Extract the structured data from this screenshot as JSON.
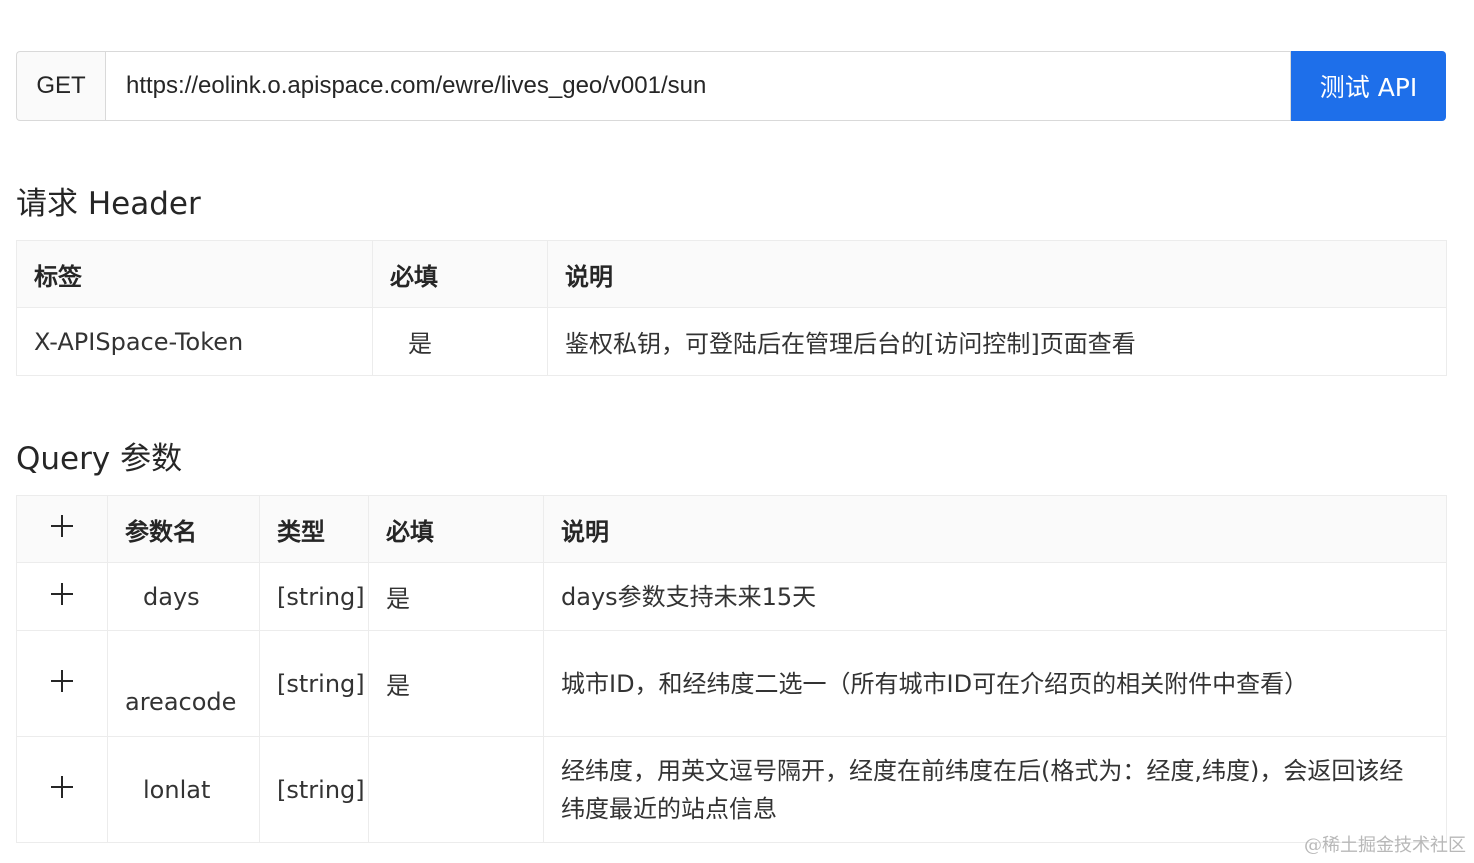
{
  "request": {
    "method": "GET",
    "url": "https://eolink.o.apispace.com/ewre/lives_geo/v001/sun",
    "test_button": "测试 API"
  },
  "header_section": {
    "title": "请求 Header",
    "columns": [
      "标签",
      "必填",
      "说明"
    ],
    "rows": [
      {
        "label": "X-APISpace-Token",
        "required": "是",
        "description": "鉴权私钥，可登陆后在管理后台的[访问控制]页面查看"
      }
    ]
  },
  "query_section": {
    "title": "Query 参数",
    "columns": [
      "参数名",
      "类型",
      "必填",
      "说明"
    ],
    "rows": [
      {
        "name": "days",
        "type": "[string]",
        "required": "是",
        "description": "days参数支持未来15天"
      },
      {
        "name": "areacode",
        "type": "[string]",
        "required": "是",
        "description": "城市ID，和经纬度二选一（所有城市ID可在介绍页的相关附件中查看）"
      },
      {
        "name": "lonlat",
        "type": "[string]",
        "required": "",
        "description": "经纬度，用英文逗号隔开，经度在前纬度在后(格式为：经度,纬度)，会返回该经纬度最近的站点信息"
      }
    ]
  },
  "watermark": "@稀土掘金技术社区"
}
